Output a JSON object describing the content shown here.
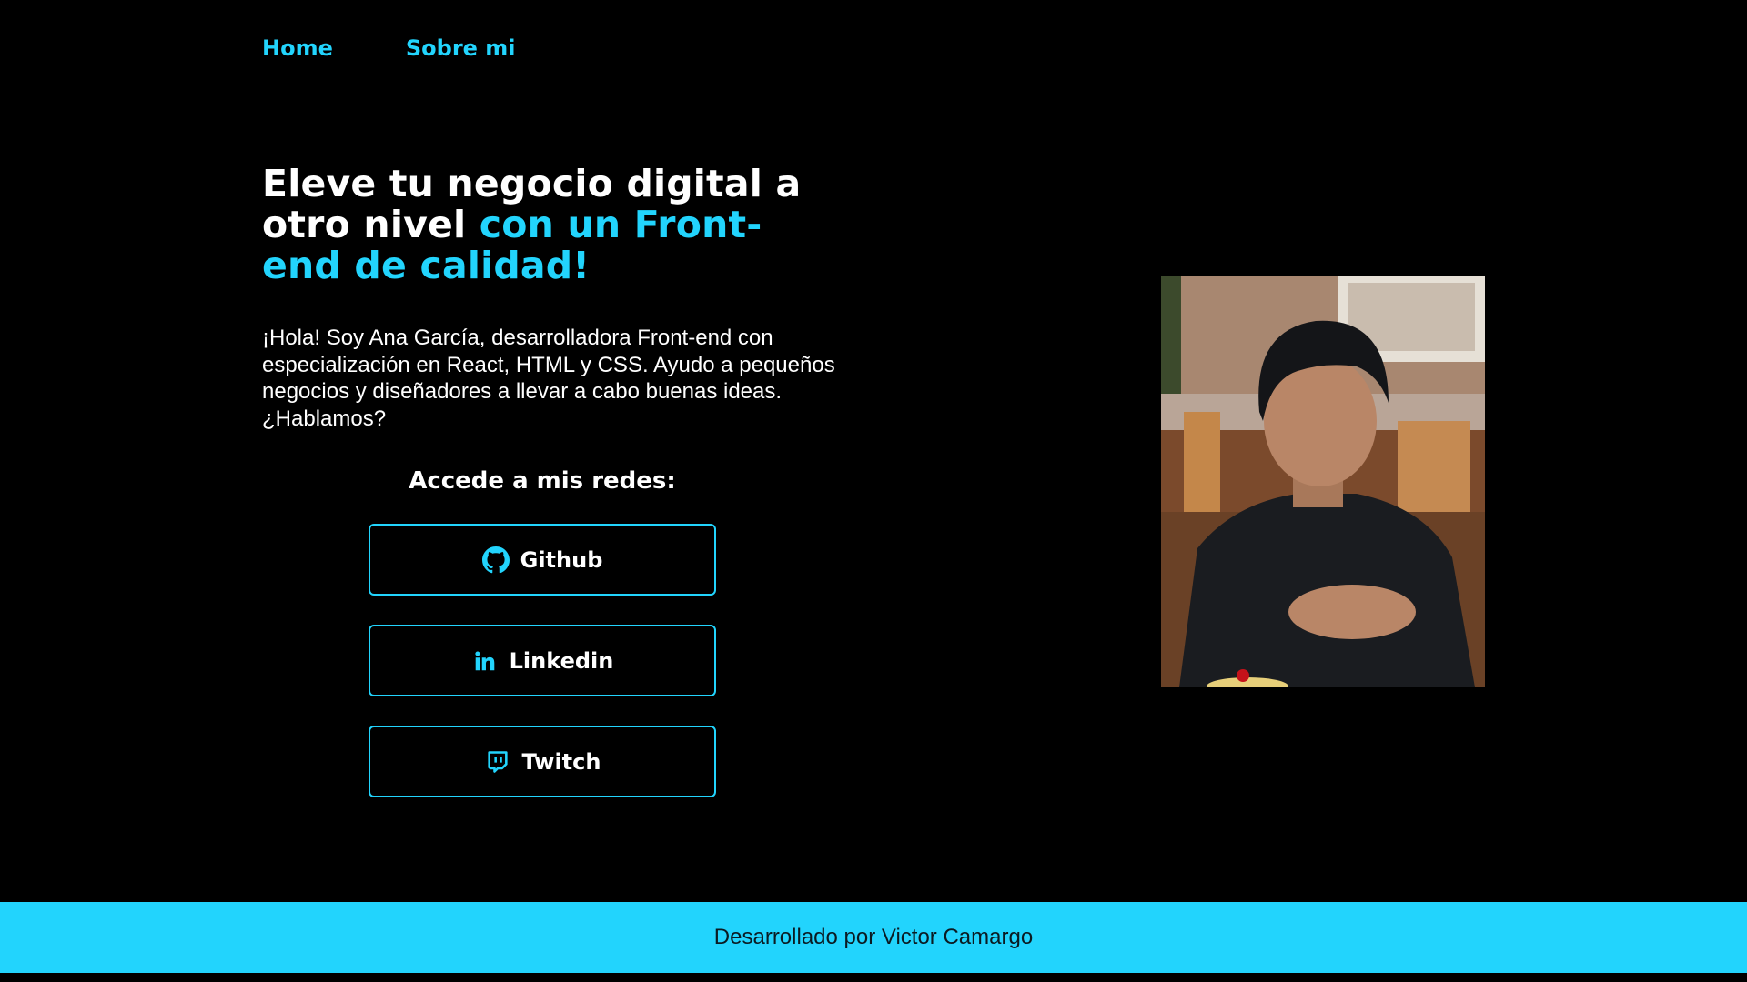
{
  "nav": {
    "home_label": "Home",
    "about_label": "Sobre mi"
  },
  "hero": {
    "headline_white": "Eleve tu negocio digital a otro nivel ",
    "headline_accent": "con un Front-end de calidad!",
    "intro": "¡Hola! Soy Ana García, desarrolladora Front-end con especialización en React, HTML y CSS. Ayudo a pequeños negocios y diseñadores a llevar a cabo buenas ideas. ¿Hablamos?"
  },
  "social": {
    "title": "Accede a mis redes:",
    "buttons": [
      {
        "label": "Github",
        "icon": "github-icon"
      },
      {
        "label": "Linkedin",
        "icon": "linkedin-icon"
      },
      {
        "label": "Twitch",
        "icon": "twitch-icon"
      }
    ]
  },
  "footer": {
    "text": "Desarrollado por Victor Camargo"
  },
  "colors": {
    "accent": "#22d4fd",
    "background": "#000000",
    "text": "#ffffff"
  }
}
